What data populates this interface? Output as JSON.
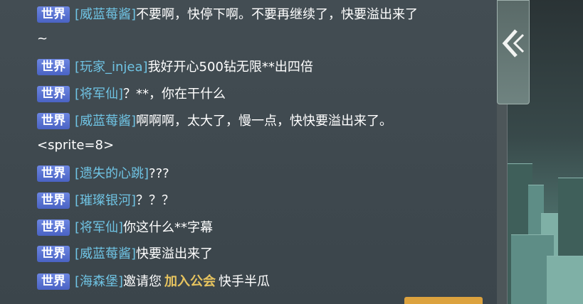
{
  "chat": {
    "messages": [
      {
        "channel": "世界",
        "sender": "[威蓝莓酱]",
        "text": "不要啊，快停下啊。不要再继续了，快要溢出来了~"
      },
      {
        "channel": "世界",
        "sender": "[玩家_injea]",
        "text": "我好开心500钻无限**出四倍"
      },
      {
        "channel": "世界",
        "sender": "[将军仙]",
        "text": "？**，你在干什么"
      },
      {
        "channel": "世界",
        "sender": "[威蓝莓酱]",
        "text": "啊啊啊，太大了，慢一点，快快要溢出来了。<sprite=8>"
      },
      {
        "channel": "世界",
        "sender": "[遗失的心跳]",
        "text": "???"
      },
      {
        "channel": "世界",
        "sender": "[璀璨银河]",
        "text": "？？？"
      },
      {
        "channel": "世界",
        "sender": "[将军仙]",
        "text": "你这什么**字幕"
      },
      {
        "channel": "世界",
        "sender": "[威蓝莓酱]",
        "text": "快要溢出来了"
      },
      {
        "channel": "世界",
        "sender": "[海森堡]",
        "text": "邀请您",
        "link": "加入公会",
        "suffix": "快手半瓜"
      }
    ]
  },
  "side": {
    "collapse_icon": "double-chevron-left-icon"
  },
  "colors": {
    "channel_badge": "#5a74d6",
    "sender": "#6fc3e3",
    "message_text": "#ffffff",
    "link": "#e7c45f",
    "panel_bg": "#3f494e"
  }
}
